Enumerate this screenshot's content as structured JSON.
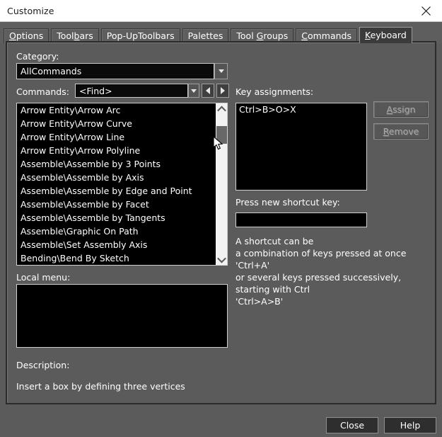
{
  "window": {
    "title": "Customize",
    "close_icon": "close-icon"
  },
  "tabs": [
    {
      "label": "Options",
      "mnemonic": "O",
      "active": false
    },
    {
      "label": "Toolbars",
      "mnemonic": "b",
      "active": false
    },
    {
      "label": "Pop-UpToolbars",
      "mnemonic": "",
      "active": false
    },
    {
      "label": "Palettes",
      "mnemonic": "",
      "active": false
    },
    {
      "label": "Tool Groups",
      "mnemonic": "G",
      "active": false
    },
    {
      "label": "Commands",
      "mnemonic": "C",
      "active": false
    },
    {
      "label": "Keyboard",
      "mnemonic": "K",
      "active": true
    }
  ],
  "keyboard_tab": {
    "category_label": "Category:",
    "category_value": "AllCommands",
    "commands_label": "Commands:",
    "commands_find_value": "<Find>",
    "prev_icon": "triangle-left-icon",
    "next_icon": "triangle-right-icon",
    "dropdown_icon": "triangle-down-icon",
    "command_list": [
      "Arrow Entity\\Arrow Arc",
      "Arrow Entity\\Arrow Curve",
      "Arrow Entity\\Arrow Line",
      "Arrow Entity\\Arrow Polyline",
      "Assemble\\Assemble by 3 Points",
      "Assemble\\Assemble by Axis",
      "Assemble\\Assemble by Edge and Point",
      "Assemble\\Assemble by Facet",
      "Assemble\\Assemble by Tangents",
      "Assemble\\Graphic On Path",
      "Assemble\\Set Assembly Axis",
      "Bending\\Bend By Sketch"
    ],
    "scroll_up_icon": "chevron-up-icon",
    "scroll_down_icon": "chevron-down-icon",
    "key_assignments_label": "Key assignments:",
    "key_assignments": [
      "Ctrl>B>O>X"
    ],
    "assign_button": "Assign",
    "assign_mnemonic": "A",
    "remove_button": "Remove",
    "remove_mnemonic": "R",
    "press_new_shortcut_label": "Press new shortcut key:",
    "shortcut_input_value": "",
    "help_lines": [
      "A shortcut can be",
      "a combination of keys pressed at once",
      "'Ctrl+A'",
      "or several keys pressed successively,",
      "starting with Ctrl",
      "'Ctrl>A>B'"
    ],
    "local_menu_label": "Local menu:",
    "local_menu_items": [],
    "description_label": "Description:",
    "description_text": "Insert a box by defining three vertices"
  },
  "footer": {
    "close_button": "Close",
    "help_button": "Help"
  }
}
